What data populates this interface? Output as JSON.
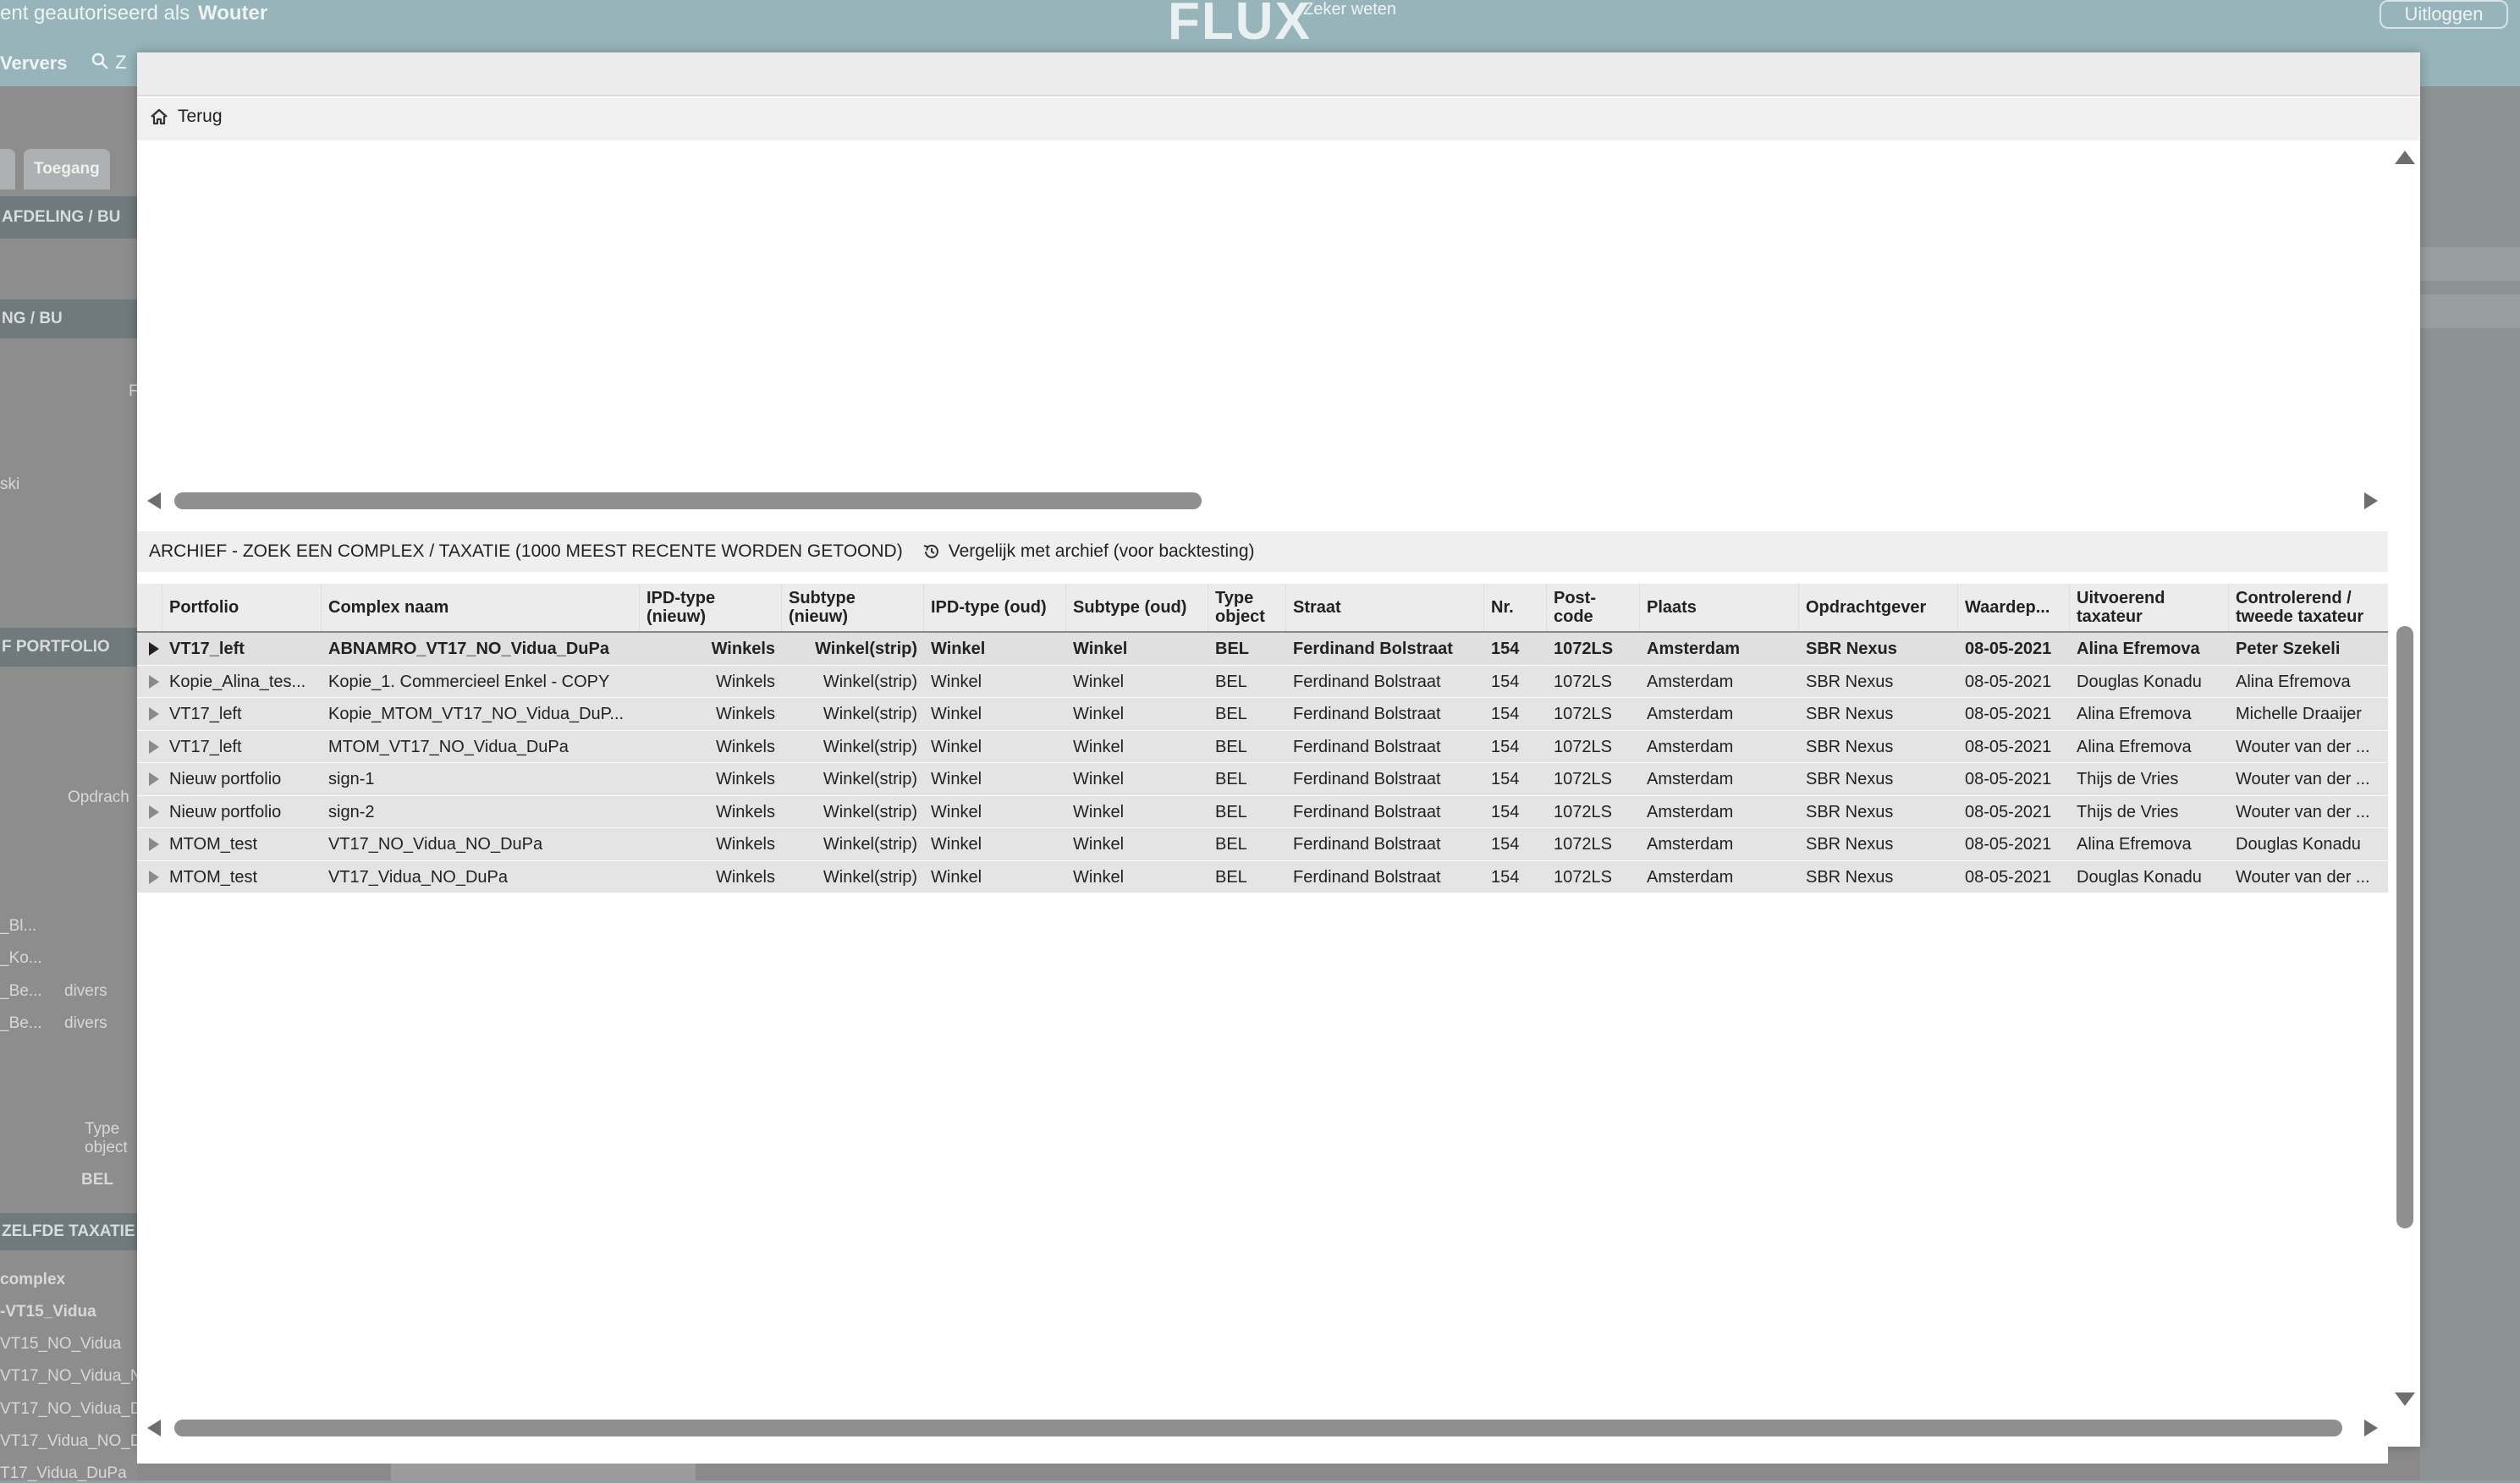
{
  "background": {
    "auth_text": "ent geautoriseerd als",
    "user_name": "Wouter",
    "logo": "FLUX",
    "tagline": "Zeker weten",
    "logout_label": "Uitloggen",
    "refresh_label": "Ververs",
    "search_label": "Z",
    "tab_a": "",
    "tab_b": "Toegang",
    "section_afdeling": "AFDELING / BU",
    "section_afdeling2": "NG / BU",
    "left_letter": "F",
    "left_frag_ski": "ski",
    "section_portfolio": "F PORTFOLIO",
    "col_opdracht": "Opdrach",
    "frag_bl": "_Bl...",
    "frag_ko": "_Ko...",
    "frag_be1": "_Be...",
    "frag_be1_val": "divers",
    "frag_be2": "_Be...",
    "frag_be2_val": "divers",
    "col_type_object": "Type object",
    "val_bel": "BEL",
    "section_zelfde": "ZELFDE TAXATIE",
    "col_complex": "complex",
    "list": [
      "-VT15_Vidua",
      "VT15_NO_Vidua",
      "VT17_NO_Vidua_N",
      "VT17_NO_Vidua_D",
      "VT17_Vidua_NO_D",
      "T17_Vidua_DuPa"
    ]
  },
  "modal": {
    "back_label": "Terug",
    "section_title": "ARCHIEF - ZOEK EEN COMPLEX / TAXATIE (1000 MEEST RECENTE WORDEN GETOOND)",
    "compare_label": "Vergelijk met archief (voor backtesting)",
    "columns": [
      "Portfolio",
      "Complex naam",
      "IPD-type (nieuw)",
      "Subtype (nieuw)",
      "IPD-type (oud)",
      "Subtype (oud)",
      "Type object",
      "Straat",
      "Nr.",
      "Post-code",
      "Plaats",
      "Opdrachtgever",
      "Waardep...",
      "Uitvoerend taxateur",
      "Controlerend / tweede taxateur"
    ],
    "rows": [
      [
        "VT17_left",
        "ABNAMRO_VT17_NO_Vidua_DuPa",
        "Winkels",
        "Winkel(strip)",
        "Winkel",
        "Winkel",
        "BEL",
        "Ferdinand Bolstraat",
        "154",
        "1072LS",
        "Amsterdam",
        "SBR Nexus",
        "08-05-2021",
        "Alina Efremova",
        "Peter Szekeli"
      ],
      [
        "Kopie_Alina_tes...",
        "Kopie_1. Commercieel Enkel - COPY",
        "Winkels",
        "Winkel(strip)",
        "Winkel",
        "Winkel",
        "BEL",
        "Ferdinand Bolstraat",
        "154",
        "1072LS",
        "Amsterdam",
        "SBR Nexus",
        "08-05-2021",
        "Douglas Konadu",
        "Alina Efremova"
      ],
      [
        "VT17_left",
        "Kopie_MTOM_VT17_NO_Vidua_DuP...",
        "Winkels",
        "Winkel(strip)",
        "Winkel",
        "Winkel",
        "BEL",
        "Ferdinand Bolstraat",
        "154",
        "1072LS",
        "Amsterdam",
        "SBR Nexus",
        "08-05-2021",
        "Alina Efremova",
        "Michelle Draaijer"
      ],
      [
        "VT17_left",
        "MTOM_VT17_NO_Vidua_DuPa",
        "Winkels",
        "Winkel(strip)",
        "Winkel",
        "Winkel",
        "BEL",
        "Ferdinand Bolstraat",
        "154",
        "1072LS",
        "Amsterdam",
        "SBR Nexus",
        "08-05-2021",
        "Alina Efremova",
        "Wouter van der ..."
      ],
      [
        "Nieuw portfolio",
        "sign-1",
        "Winkels",
        "Winkel(strip)",
        "Winkel",
        "Winkel",
        "BEL",
        "Ferdinand Bolstraat",
        "154",
        "1072LS",
        "Amsterdam",
        "SBR Nexus",
        "08-05-2021",
        "Thijs de Vries",
        "Wouter van der ..."
      ],
      [
        "Nieuw portfolio",
        "sign-2",
        "Winkels",
        "Winkel(strip)",
        "Winkel",
        "Winkel",
        "BEL",
        "Ferdinand Bolstraat",
        "154",
        "1072LS",
        "Amsterdam",
        "SBR Nexus",
        "08-05-2021",
        "Thijs de Vries",
        "Wouter van der ..."
      ],
      [
        "MTOM_test",
        "VT17_NO_Vidua_NO_DuPa",
        "Winkels",
        "Winkel(strip)",
        "Winkel",
        "Winkel",
        "BEL",
        "Ferdinand Bolstraat",
        "154",
        "1072LS",
        "Amsterdam",
        "SBR Nexus",
        "08-05-2021",
        "Alina Efremova",
        "Douglas Konadu"
      ],
      [
        "MTOM_test",
        "VT17_Vidua_NO_DuPa",
        "Winkels",
        "Winkel(strip)",
        "Winkel",
        "Winkel",
        "BEL",
        "Ferdinand Bolstraat",
        "154",
        "1072LS",
        "Amsterdam",
        "SBR Nexus",
        "08-05-2021",
        "Douglas Konadu",
        "Wouter van der ..."
      ]
    ],
    "selected_row": 0
  }
}
